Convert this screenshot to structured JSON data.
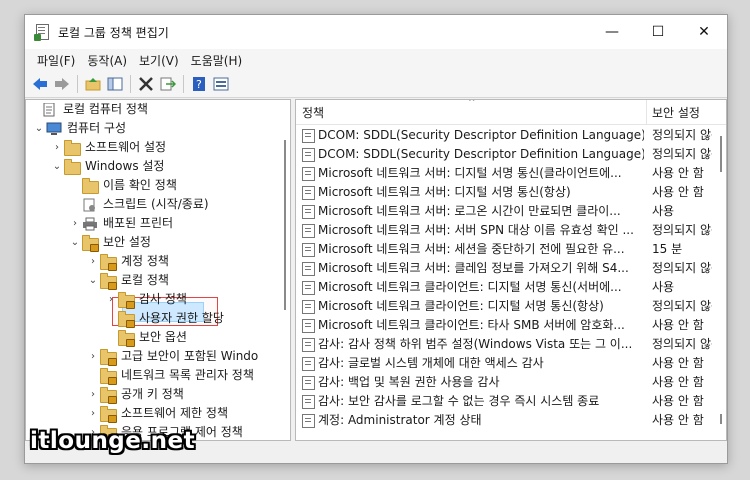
{
  "window": {
    "title": "로컬 그룹 정책 편집기",
    "controls": [
      "—",
      "☐",
      "✕"
    ]
  },
  "menu": [
    "파일(F)",
    "동작(A)",
    "보기(V)",
    "도움말(H)"
  ],
  "toolbar": {
    "icons": [
      "back-arrow-icon",
      "forward-arrow-icon",
      "up-folder-icon",
      "show-tree-icon",
      "delete-icon",
      "export-icon",
      "help-icon",
      "properties-icon"
    ]
  },
  "tree": {
    "items": [
      {
        "label": "로컬 컴퓨터 정책",
        "arrow": "",
        "icon": "policy-doc-icon"
      },
      {
        "label": "컴퓨터 구성",
        "arrow": "⌄",
        "icon": "computer-icon"
      },
      {
        "label": "소프트웨어 설정",
        "arrow": "›",
        "icon": "folder-icon"
      },
      {
        "label": "Windows 설정",
        "arrow": "⌄",
        "icon": "folder-icon"
      },
      {
        "label": "이름 확인 정책",
        "arrow": "",
        "icon": "folder-icon"
      },
      {
        "label": "스크립트 (시작/종료)",
        "arrow": "",
        "icon": "script-icon"
      },
      {
        "label": "배포된 프린터",
        "arrow": "›",
        "icon": "printer-icon"
      },
      {
        "label": "보안 설정",
        "arrow": "⌄",
        "icon": "folder-lock-icon"
      },
      {
        "label": "계정 정책",
        "arrow": "›",
        "icon": "folder-lock-icon"
      },
      {
        "label": "로컬 정책",
        "arrow": "⌄",
        "icon": "folder-lock-icon"
      },
      {
        "label": "감사 정책",
        "arrow": "›",
        "icon": "folder-lock-icon"
      },
      {
        "label": "사용자 권한 할당",
        "arrow": "",
        "icon": "folder-lock-icon"
      },
      {
        "label": "보안 옵션",
        "arrow": "",
        "icon": "folder-lock-icon"
      },
      {
        "label": "고급 보안이 포함된 Windo",
        "arrow": "›",
        "icon": "folder-lock-icon"
      },
      {
        "label": "네트워크 목록 관리자 정책",
        "arrow": "",
        "icon": "folder-lock-icon"
      },
      {
        "label": "공개 키 정책",
        "arrow": "›",
        "icon": "folder-lock-icon"
      },
      {
        "label": "소프트웨어 제한 정책",
        "arrow": "›",
        "icon": "folder-lock-icon"
      },
      {
        "label": "응용 프로그램 제어 정책",
        "arrow": "›",
        "icon": "folder-lock-icon"
      }
    ],
    "selected": "보안 옵션"
  },
  "list": {
    "col_policy": "정책",
    "col_setting": "보안 설정",
    "rows": [
      {
        "policy": "DCOM: SDDL(Security Descriptor Definition Language) 구...",
        "setting": "정의되지 않음"
      },
      {
        "policy": "DCOM: SDDL(Security Descriptor Definition Language) 구...",
        "setting": "정의되지 않음"
      },
      {
        "policy": "Microsoft 네트워크 서버: 디지털 서명 통신(클라이언트에...",
        "setting": "사용 안 함"
      },
      {
        "policy": "Microsoft 네트워크 서버: 디지털 서명 통신(항상)",
        "setting": "사용 안 함"
      },
      {
        "policy": "Microsoft 네트워크 서버: 로그온 시간이 만료되면 클라이...",
        "setting": "사용"
      },
      {
        "policy": "Microsoft 네트워크 서버: 서버 SPN 대상 이름 유효성 확인 ...",
        "setting": "정의되지 않음"
      },
      {
        "policy": "Microsoft 네트워크 서버: 세션을 중단하기 전에 필요한 유...",
        "setting": "15 분"
      },
      {
        "policy": "Microsoft 네트워크 서버: 클레임 정보를 가져오기 위해 S4...",
        "setting": "정의되지 않음"
      },
      {
        "policy": "Microsoft 네트워크 클라이언트: 디지털 서명 통신(서버에...",
        "setting": "사용"
      },
      {
        "policy": "Microsoft 네트워크 클라이언트: 디지털 서명 통신(항상)",
        "setting": "정의되지 않음"
      },
      {
        "policy": "Microsoft 네트워크 클라이언트: 타사 SMB 서버에 암호화...",
        "setting": "사용 안 함"
      },
      {
        "policy": "감사: 감사 정책 하위 범주 설정(Windows Vista 또는 그 이...",
        "setting": "정의되지 않음"
      },
      {
        "policy": "감사: 글로벌 시스템 개체에 대한 액세스 감사",
        "setting": "사용 안 함"
      },
      {
        "policy": "감사: 백업 및 복원 권한 사용을 감사",
        "setting": "사용 안 함"
      },
      {
        "policy": "감사: 보안 감사를 로그할 수 없는 경우 즉시 시스템 종료",
        "setting": "사용 안 함"
      },
      {
        "policy": "계정: Administrator 계정 상태",
        "setting": "사용 안 함"
      }
    ]
  },
  "watermark": "itlounge.net"
}
